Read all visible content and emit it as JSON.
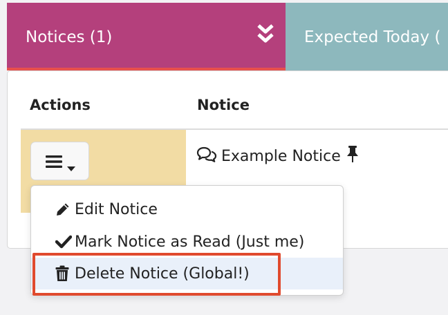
{
  "tabs": {
    "notices_label": "Notices (1)",
    "expected_label": "Expected Today (",
    "notices_color": "#b4407c",
    "expected_color": "#8db8bd",
    "active_underline": "#e8504c"
  },
  "table": {
    "headers": [
      "Actions",
      "Notice"
    ],
    "row": {
      "title": "Example Notice",
      "icons": [
        "comments-icon",
        "pin-icon"
      ]
    }
  },
  "menu": {
    "toggle_icons": [
      "hamburger-icon",
      "caret-down-icon"
    ],
    "items": [
      {
        "label": "Edit Notice",
        "icon": "pencil-icon"
      },
      {
        "label": "Mark Notice as Read (Just me)",
        "icon": "check-icon"
      },
      {
        "label": "Delete Notice (Global!)",
        "icon": "trash-icon"
      }
    ]
  },
  "highlight_color": "#e04a2e"
}
